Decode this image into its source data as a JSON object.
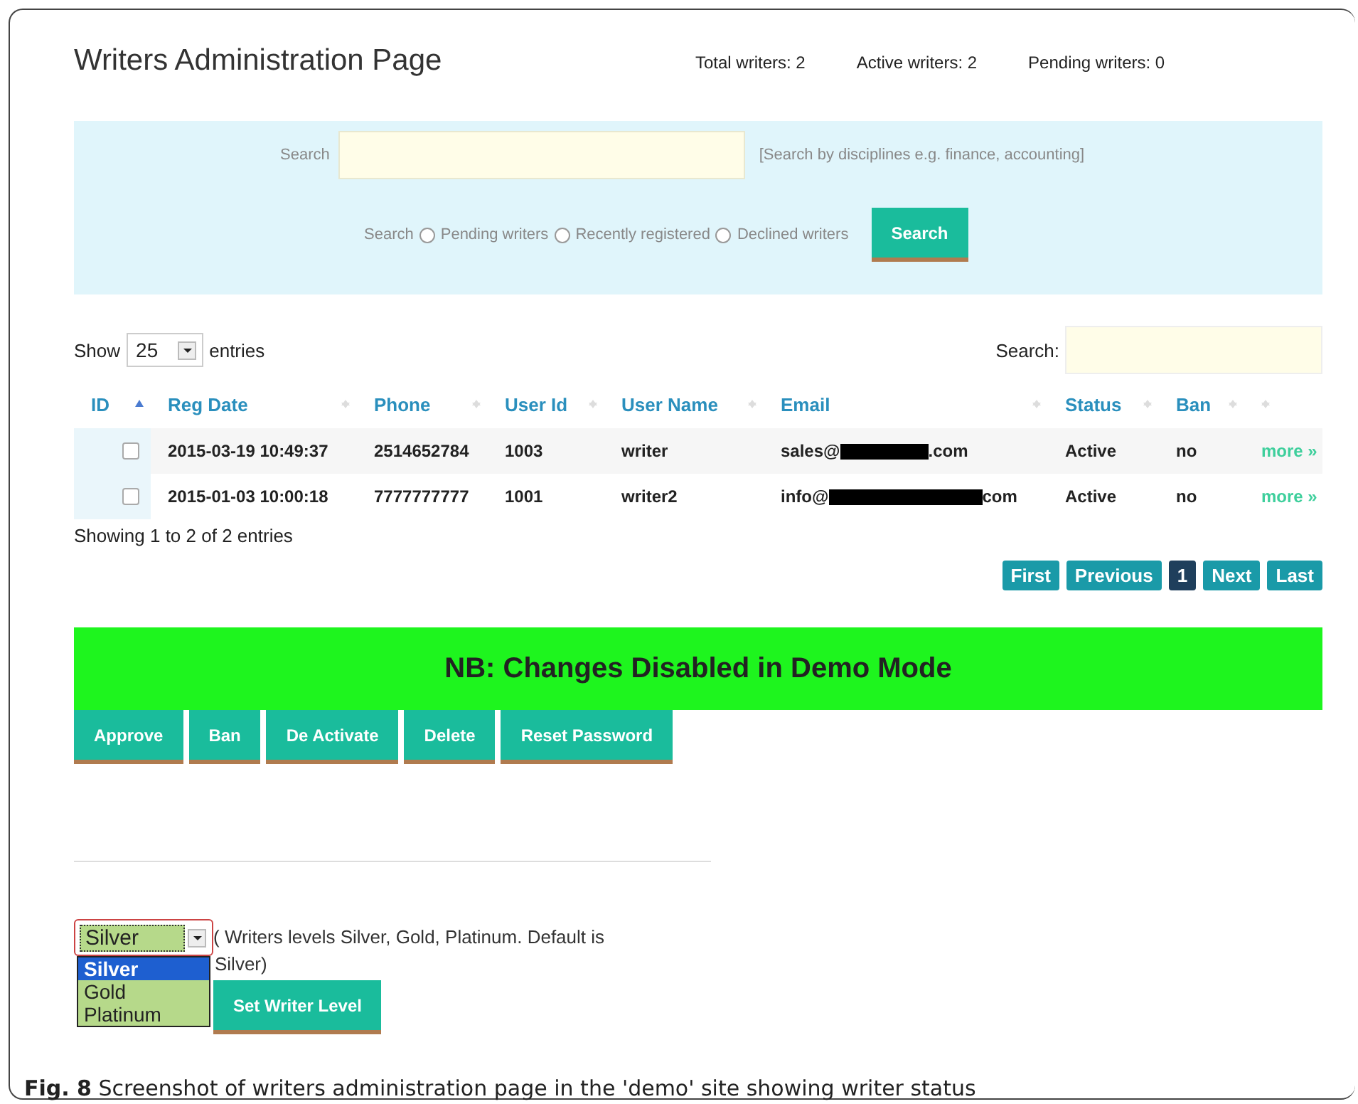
{
  "page": {
    "title": "Writers Administration Page",
    "stats": [
      "Total writers: 2",
      "Active writers: 2",
      "Pending writers: 0"
    ]
  },
  "search_panel": {
    "label": "Search",
    "hint": "[Search by disciplines e.g. finance, accounting]",
    "filter_label": "Search",
    "filters": [
      {
        "label": "Pending writers",
        "selected": false
      },
      {
        "label": "Recently registered",
        "selected": false
      },
      {
        "label": "Declined writers",
        "selected": false
      }
    ],
    "button": "Search"
  },
  "table_controls": {
    "show_label": "Show",
    "page_size": "25",
    "entries_label": "entries",
    "search_label": "Search:"
  },
  "table": {
    "columns": [
      {
        "label": "ID",
        "sorted": true
      },
      {
        "label": "Reg Date",
        "sorted": false
      },
      {
        "label": "Phone",
        "sorted": false
      },
      {
        "label": "User Id",
        "sorted": false
      },
      {
        "label": "User Name",
        "sorted": false
      },
      {
        "label": "Email",
        "sorted": false
      },
      {
        "label": "Status",
        "sorted": false
      },
      {
        "label": "Ban",
        "sorted": false
      },
      {
        "sorted": false
      }
    ],
    "rows": [
      {
        "checked": false,
        "reg_date": "2015-03-19 10:49:37",
        "phone": "2514652784",
        "user_id": "1003",
        "user_name": "writer",
        "email": {
          "start": "sales@",
          "end": ".com",
          "redacted": true
        },
        "status": "Active",
        "ban": "no",
        "link": "more »"
      },
      {
        "checked": false,
        "reg_date": "2015-01-03 10:00:18",
        "phone": "7777777777",
        "user_id": "1001",
        "user_name": "writer2",
        "email": {
          "start": "info@",
          "end": "com",
          "redacted": true
        },
        "status": "Active",
        "ban": "no",
        "link": "more »"
      }
    ]
  },
  "table_info": "Showing 1 to 2 of 2 entries",
  "pagination": [
    {
      "label": "First",
      "selected": false
    },
    {
      "label": "Previous",
      "selected": false
    },
    {
      "label": "1",
      "selected": true
    },
    {
      "label": "Next",
      "selected": false
    },
    {
      "label": "Last",
      "selected": false
    }
  ],
  "notice": "NB: Changes Disabled in Demo Mode",
  "actions": [
    "Approve",
    "Ban",
    "De Activate",
    "Delete",
    "Reset Password"
  ],
  "level": {
    "value": "Silver",
    "options": [
      {
        "label": "Silver",
        "selected": true
      },
      {
        "label": "Gold",
        "selected": false
      },
      {
        "label": "Platinum",
        "selected": false
      }
    ],
    "note_line_1": "( Writers levels Silver, Gold, Platinum. Default is",
    "note_line_2": "Silver)",
    "button": "Set Writer Level"
  },
  "caption": "**Fig. 8** Screenshot of writers administration page in the 'demo' site showing writer status"
}
